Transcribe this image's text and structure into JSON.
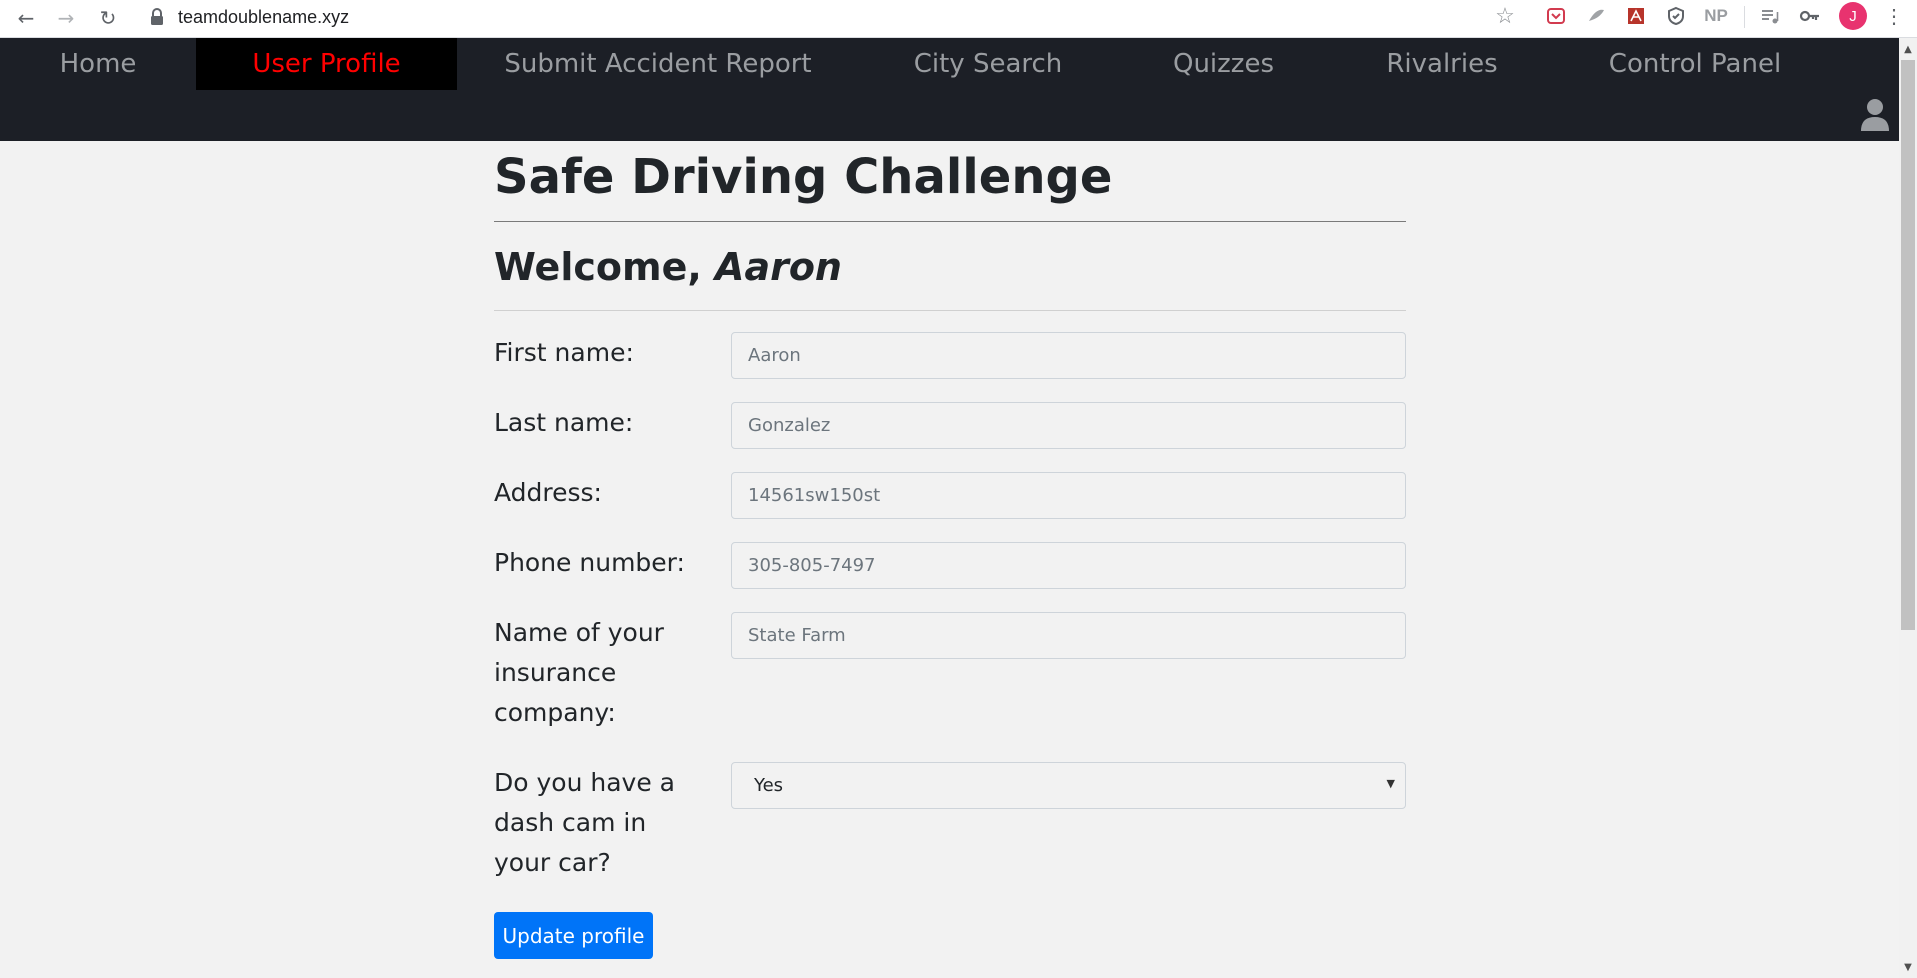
{
  "browser": {
    "url": "teamdoublename.xyz",
    "avatar_letter": "J",
    "extensions": [
      "star-icon",
      "pocket-icon",
      "feather-icon",
      "pdf-icon",
      "shield-icon",
      "np-icon",
      "playlist-icon",
      "key-icon",
      "more-icon"
    ],
    "np_label": "NP"
  },
  "nav": {
    "items": [
      {
        "label": "Home"
      },
      {
        "label": "User Profile",
        "active": true
      },
      {
        "label": "Submit Accident Report"
      },
      {
        "label": "City Search"
      },
      {
        "label": "Quizzes"
      },
      {
        "label": "Rivalries"
      },
      {
        "label": "Control Panel"
      }
    ]
  },
  "page": {
    "title": "Safe Driving Challenge",
    "welcome_prefix": "Welcome, ",
    "welcome_name": "Aaron"
  },
  "form": {
    "first_name": {
      "label": "First name:",
      "placeholder": "Aaron"
    },
    "last_name": {
      "label": "Last name:",
      "placeholder": "Gonzalez"
    },
    "address": {
      "label": "Address:",
      "placeholder": "14561sw150st"
    },
    "phone": {
      "label": "Phone number:",
      "placeholder": "305-805-7497"
    },
    "insurance": {
      "label": "Name of your insurance company:",
      "placeholder": "State Farm"
    },
    "dashcam": {
      "label": "Do you have a dash cam in your car?",
      "selected": "Yes"
    },
    "submit_label": "Update profile"
  },
  "colors": {
    "navbar_bg": "#1c1f26",
    "nav_active_text": "#ff0000",
    "nav_active_bg": "#000000",
    "button_bg": "#0074f8",
    "page_bg": "#f2f2f2"
  }
}
